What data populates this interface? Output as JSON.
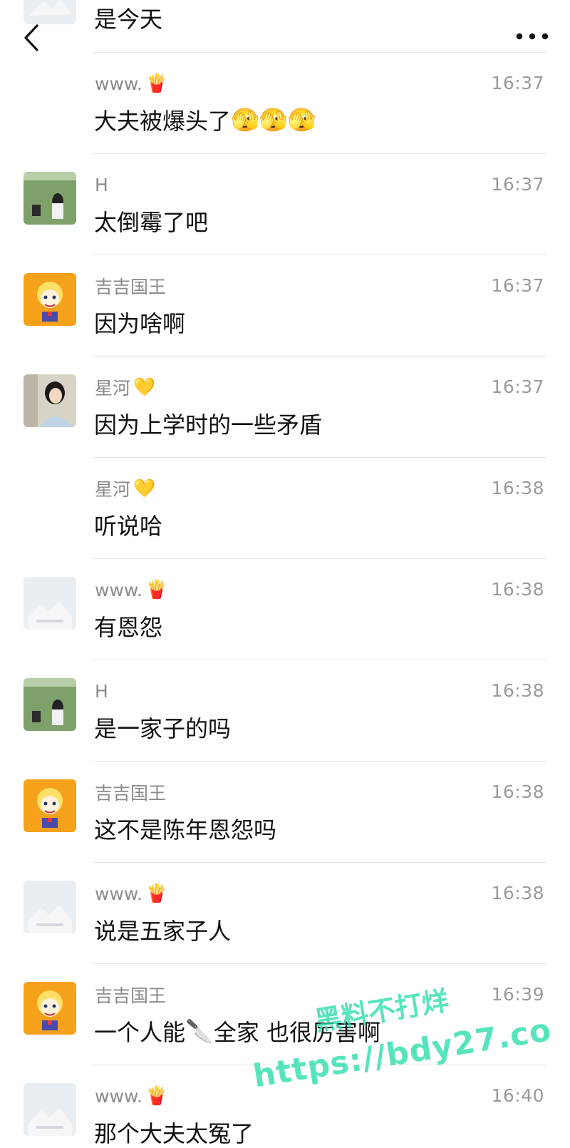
{
  "header": {
    "back_icon": "chevron-left-icon",
    "more_icon": "more-dots-icon"
  },
  "top_partial": {
    "text": "是今天",
    "avatar": "placeholder-avatar"
  },
  "messages": [
    {
      "sender": "www.",
      "sender_emoji": "🍟",
      "time": "16:37",
      "text": "大夫被爆头了",
      "text_emoji": "🫣🫣🫣",
      "avatar": "none"
    },
    {
      "sender": "H",
      "sender_emoji": "",
      "time": "16:37",
      "text": "太倒霉了吧",
      "text_emoji": "",
      "avatar": "grass-photo-avatar"
    },
    {
      "sender": "吉吉国王",
      "sender_emoji": "",
      "time": "16:37",
      "text": "因为啥啊",
      "text_emoji": "",
      "avatar": "anime-avatar"
    },
    {
      "sender": "星河",
      "sender_emoji": "💛",
      "time": "16:37",
      "text": "因为上学时的一些矛盾",
      "text_emoji": "",
      "avatar": "girl-photo-avatar"
    },
    {
      "sender": "星河",
      "sender_emoji": "💛",
      "time": "16:38",
      "text": "听说哈",
      "text_emoji": "",
      "avatar": "none"
    },
    {
      "sender": "www.",
      "sender_emoji": "🍟",
      "time": "16:38",
      "text": "有恩怨",
      "text_emoji": "",
      "avatar": "placeholder-avatar"
    },
    {
      "sender": "H",
      "sender_emoji": "",
      "time": "16:38",
      "text": "是一家子的吗",
      "text_emoji": "",
      "avatar": "grass-photo-avatar"
    },
    {
      "sender": "吉吉国王",
      "sender_emoji": "",
      "time": "16:38",
      "text": "这不是陈年恩怨吗",
      "text_emoji": "",
      "avatar": "anime-avatar"
    },
    {
      "sender": "www.",
      "sender_emoji": "🍟",
      "time": "16:38",
      "text": "说是五家子人",
      "text_emoji": "",
      "avatar": "placeholder-avatar"
    },
    {
      "sender": "吉吉国王",
      "sender_emoji": "",
      "time": "16:39",
      "text": "一个人能",
      "text_emoji": "🔪",
      "text_after": "全家 也很厉害啊",
      "avatar": "anime-avatar"
    },
    {
      "sender": "www.",
      "sender_emoji": "🍟",
      "time": "16:40",
      "text": "那个大夫太冤了",
      "text_emoji": "",
      "avatar": "placeholder-avatar"
    }
  ],
  "watermark": {
    "line1": "黑料不打烊",
    "line2": "https://bdy27.co",
    "color": "#28dcaa"
  }
}
